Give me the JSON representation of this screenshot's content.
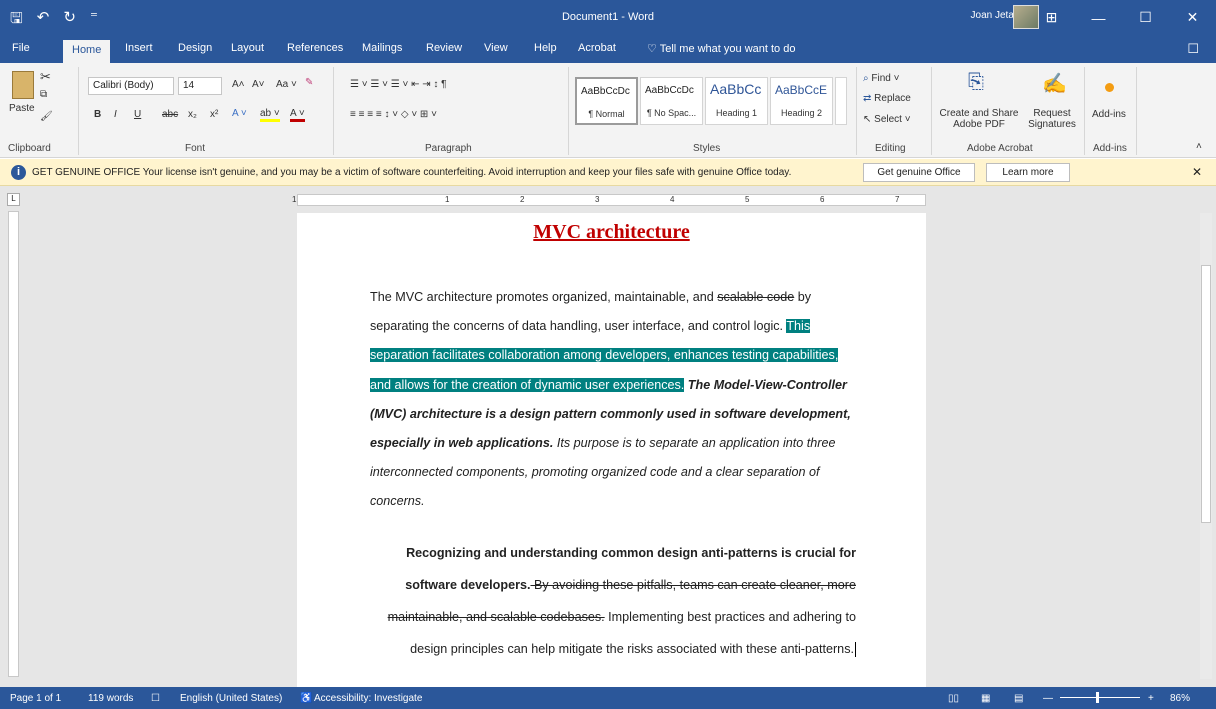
{
  "window": {
    "doc_title": "Document1  -  Word",
    "user": "Joan Jetalam",
    "qat": {
      "save": "🖫",
      "undo": "↶",
      "redo": "↻",
      "more": "⁼"
    },
    "controls": {
      "ribbon_display": "⊞",
      "minimize": "—",
      "maximize": "☐",
      "close": "✕"
    }
  },
  "tabs": {
    "file": "File",
    "home": "Home",
    "insert": "Insert",
    "design": "Design",
    "layout": "Layout",
    "references": "References",
    "mailings": "Mailings",
    "review": "Review",
    "view": "View",
    "help": "Help",
    "acrobat": "Acrobat",
    "tell_me": "Tell me what you want to do",
    "comments": "☐"
  },
  "ribbon": {
    "clipboard": {
      "paste": "Paste",
      "label": "Clipboard"
    },
    "font": {
      "name": "Calibri (Body)",
      "size": "14",
      "grow": "A˄",
      "shrink": "A˅",
      "case": "Aa ˅",
      "bold": "B",
      "italic": "I",
      "underline": "U",
      "strike": "abc",
      "subscript": "x₂",
      "superscript": "x²",
      "label": "Font"
    },
    "paragraph": {
      "row1": "☰ ˅  ☰ ˅  ☰ ˅   ⇤ ⇥   ↕   ¶",
      "row2": "≡  ≡  ≡  ≡   ↕ ˅   ◇ ˅  ⊞ ˅",
      "label": "Paragraph"
    },
    "styles": {
      "items": [
        {
          "preview": "AaBbCcDc",
          "name": "¶ Normal"
        },
        {
          "preview": "AaBbCcDc",
          "name": "¶ No Spac..."
        },
        {
          "preview": "AaBbCc",
          "name": "Heading 1"
        },
        {
          "preview": "AaBbCcE",
          "name": "Heading 2"
        }
      ],
      "label": "Styles"
    },
    "editing": {
      "find": "Find ˅",
      "replace": "Replace",
      "select": "Select ˅",
      "label": "Editing"
    },
    "acrobat": {
      "create_share_1": "Create and Share",
      "create_share_2": "Adobe PDF",
      "request_1": "Request",
      "request_2": "Signatures",
      "label": "Adobe Acrobat"
    },
    "addins": {
      "button": "Add-ins",
      "label": "Add-ins"
    }
  },
  "message_bar": {
    "text": "GET GENUINE OFFICE   Your license isn't genuine, and you may be a victim of software counterfeiting. Avoid interruption and keep your files safe with genuine Office today.",
    "button1": "Get genuine Office",
    "button2": "Learn more",
    "close": "✕"
  },
  "document": {
    "heading": "MVC architecture",
    "p1_a": "The MVC architecture promotes organized, maintainable, and ",
    "p1_strike": "scalable code",
    "p1_b": " by separating the concerns of data handling, user interface, and control logic. ",
    "p1_highlight": "This separation facilitates collaboration among developers, enhances testing capabilities, and allows for the creation of dynamic user experiences.",
    "p1_bold_italic": " The Model-View-Controller (MVC) architecture is a design pattern commonly used in software development, especially in web applications.",
    "p1_italic": " Its purpose is to separate an application into three interconnected components, promoting organized code and a clear separation of concerns.",
    "p2_bold": "Recognizing and understanding common design anti-patterns is crucial for software developers.",
    "p2_strike": " By avoiding these pitfalls, teams can create cleaner, more maintainable, and scalable codebases.",
    "p2_normal": " Implementing best practices and adhering to design principles can help mitigate the risks associated with these anti-patterns."
  },
  "ruler_numbers": [
    "1",
    "1",
    "2",
    "3",
    "4",
    "5",
    "6",
    "7"
  ],
  "status": {
    "page": "Page 1 of 1",
    "words": "119 words",
    "language": "English (United States)",
    "accessibility": "Accessibility: Investigate",
    "zoom": "86%"
  },
  "colors": {
    "brand": "#2b579a",
    "highlight": "#008080",
    "heading": "#c00000",
    "message_bar": "#fff4ce"
  }
}
